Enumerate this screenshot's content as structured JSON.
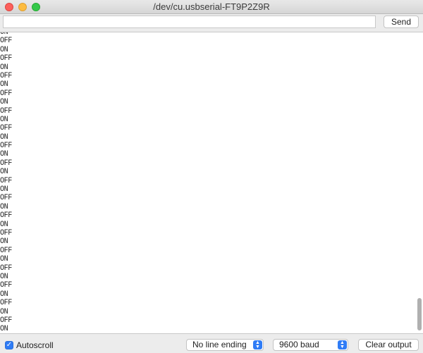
{
  "window": {
    "title": "/dev/cu.usbserial-FT9P2Z9R"
  },
  "toolbar": {
    "input_value": "",
    "send_label": "Send"
  },
  "output": {
    "lines": [
      "ON",
      "OFF",
      "ON",
      "OFF",
      "ON",
      "OFF",
      "ON",
      "OFF",
      "ON",
      "OFF",
      "ON",
      "OFF",
      "ON",
      "OFF",
      "ON",
      "OFF",
      "ON",
      "OFF",
      "ON",
      "OFF",
      "ON",
      "OFF",
      "ON",
      "OFF",
      "ON",
      "OFF",
      "ON",
      "OFF",
      "ON",
      "OFF",
      "ON",
      "OFF",
      "ON",
      "OFF",
      "ON",
      "OFF"
    ]
  },
  "footer": {
    "autoscroll_label": "Autoscroll",
    "autoscroll_checked": true,
    "line_ending_value": "No line ending",
    "baud_value": "9600 baud",
    "clear_label": "Clear output"
  },
  "colors": {
    "accent": "#2f7cf6",
    "traffic_close": "#fc605c",
    "traffic_min": "#fdbc40",
    "traffic_max": "#34c84a"
  },
  "icons": {
    "checkbox": "checkmark-icon",
    "select_arrows": "up-down-chevron-icon"
  }
}
